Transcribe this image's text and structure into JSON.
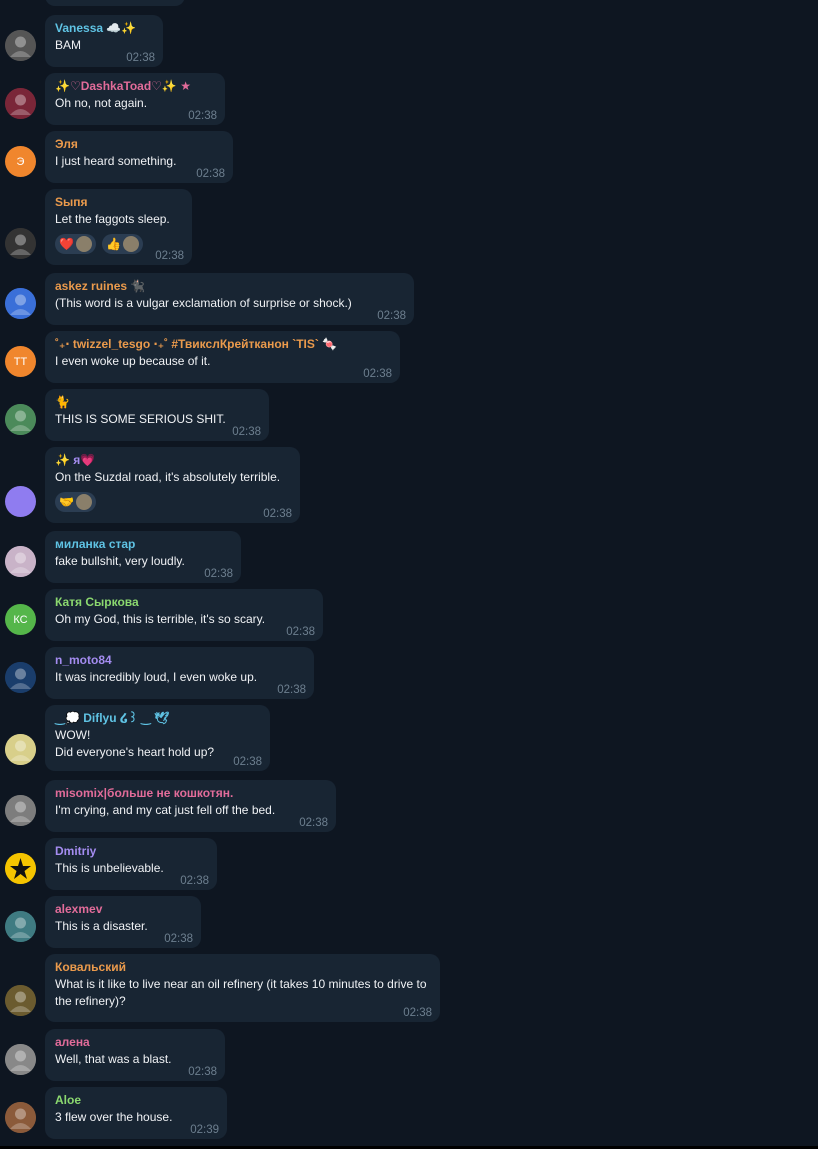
{
  "colors": {
    "background": "#0e1621",
    "bubble": "#182533",
    "time": "#6d7f8f",
    "name_cyan": "#5fc3e4",
    "name_orange": "#ea9a4c",
    "name_green": "#8bd86f",
    "name_purple": "#a48cf0",
    "name_pink": "#e26c9a"
  },
  "messages": [
    {
      "sender": "Vanessa ☁️✨",
      "sender_color": "#5fc3e4",
      "lines": [
        "BAM"
      ],
      "time": "02:38",
      "avatar_icon": "photo-avatar",
      "avatar_color": "#555"
    },
    {
      "sender": "✨♡DashkaToad♡✨ ★",
      "sender_color": "#e26c9a",
      "lines": [
        "Oh no, not again."
      ],
      "time": "02:38",
      "avatar_icon": "photo-avatar",
      "avatar_color": "#7a2638"
    },
    {
      "sender": "Эля",
      "sender_color": "#ea9a4c",
      "lines": [
        "I just heard something."
      ],
      "time": "02:38",
      "avatar_text": "Э",
      "avatar_color": "#f0862d"
    },
    {
      "sender": "Sыпя",
      "sender_color": "#ea9a4c",
      "lines": [
        "Let the faggots sleep."
      ],
      "time": "02:38",
      "avatar_icon": "photo-avatar",
      "avatar_color": "#333",
      "reactions": [
        "❤️",
        "👍"
      ]
    },
    {
      "sender": "askez ruines 🐈‍⬛",
      "sender_color": "#ea9a4c",
      "lines": [
        "(This word is a vulgar exclamation of surprise or shock.)"
      ],
      "time": "02:38",
      "avatar_icon": "photo-avatar",
      "avatar_color": "#3a6fd8"
    },
    {
      "sender": "˚₊‧ twizzel_tesgo ‧₊˚ #ТвикслКрейтканон `TIS` 🍬",
      "sender_color": "#ea9a4c",
      "lines": [
        "I even woke up because of it."
      ],
      "time": "02:38",
      "avatar_text": "TT",
      "avatar_color": "#f0862d"
    },
    {
      "sender": "🐈",
      "sender_color": "#cccccc",
      "lines": [
        "THIS IS SOME SERIOUS SHIT."
      ],
      "time": "02:38",
      "avatar_icon": "photo-avatar",
      "avatar_color": "#4b8a5a"
    },
    {
      "sender": "✨ я💗",
      "sender_color": "#a48cf0",
      "lines": [
        "On the Suzdal road, it's absolutely terrible."
      ],
      "time": "02:38",
      "avatar_text": "",
      "avatar_color": "#8f7cf0",
      "reactions": [
        "🤝"
      ]
    },
    {
      "sender": "миланка стар",
      "sender_color": "#5fc3e4",
      "lines": [
        "fake bullshit, very loudly."
      ],
      "time": "02:38",
      "avatar_icon": "photo-avatar",
      "avatar_color": "#c9b3c8"
    },
    {
      "sender": "Катя Сыркова",
      "sender_color": "#8bd86f",
      "lines": [
        "Oh my God, this is terrible, it's so scary."
      ],
      "time": "02:38",
      "avatar_text": "КС",
      "avatar_color": "#55b64a"
    },
    {
      "sender": "n_moto84",
      "sender_color": "#a48cf0",
      "lines": [
        "It was incredibly loud, I even woke up."
      ],
      "time": "02:38",
      "avatar_icon": "photo-avatar",
      "avatar_color": "#1a3d6b"
    },
    {
      "sender": "‿💭 Diflyu ໒꒱ ‿ 🕊",
      "sender_color": "#5fc3e4",
      "lines": [
        "WOW!",
        "Did everyone's heart hold up?"
      ],
      "time": "02:38",
      "avatar_icon": "photo-avatar",
      "avatar_color": "#d8cf8a"
    },
    {
      "sender": "misomix|больше не кошкотян.",
      "sender_color": "#e26c9a",
      "lines": [
        "I'm crying, and my cat just fell off the bed."
      ],
      "time": "02:38",
      "avatar_icon": "photo-avatar",
      "avatar_color": "#7d7d7d"
    },
    {
      "sender": "Dmitriy",
      "sender_color": "#a48cf0",
      "lines": [
        "This is unbelievable."
      ],
      "time": "02:38",
      "avatar_icon": "star-avatar",
      "avatar_color": "#f5c400"
    },
    {
      "sender": "alexmev",
      "sender_color": "#e26c9a",
      "lines": [
        "This is a disaster."
      ],
      "time": "02:38",
      "avatar_icon": "photo-avatar",
      "avatar_color": "#3f7b82"
    },
    {
      "sender": "Ковальский",
      "sender_color": "#ea9a4c",
      "lines": [
        "What is it like to live near an oil refinery (it takes 10 minutes to drive to the refinery)?"
      ],
      "time": "02:38",
      "avatar_icon": "photo-avatar",
      "avatar_color": "#6b5b2f"
    },
    {
      "sender": "алена",
      "sender_color": "#e26c9a",
      "lines": [
        "Well, that was a blast."
      ],
      "time": "02:38",
      "avatar_icon": "photo-avatar",
      "avatar_color": "#888888"
    },
    {
      "sender": "Aloe",
      "sender_color": "#8bd86f",
      "lines": [
        "3 flew over the house."
      ],
      "time": "02:39",
      "avatar_icon": "photo-avatar",
      "avatar_color": "#8b5a3a"
    }
  ]
}
